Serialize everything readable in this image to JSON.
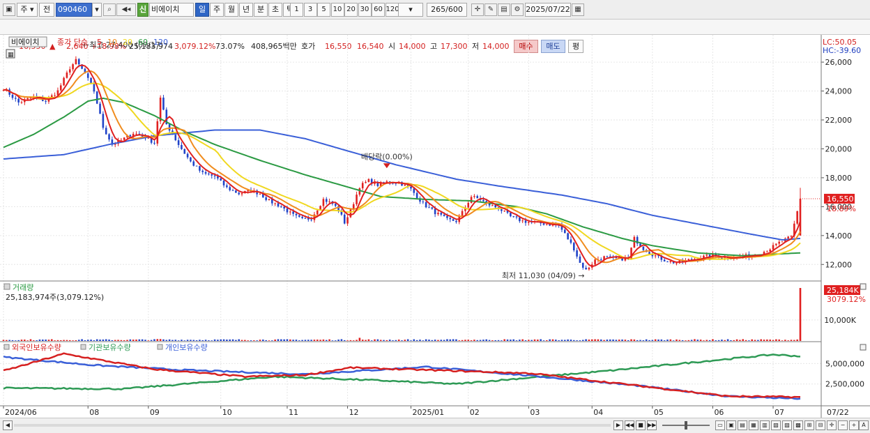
{
  "toolbar": {
    "market": "주",
    "type": "전",
    "code": "090460",
    "badge": "신",
    "name": "비에이치",
    "periods": [
      "일",
      "주",
      "월",
      "년",
      "분",
      "초",
      "틱"
    ],
    "active_period": "일",
    "minutes": [
      "1",
      "3",
      "5",
      "10",
      "20",
      "30",
      "60",
      "120"
    ],
    "count": "265",
    "count_total": "/600",
    "date": "2025/07/22"
  },
  "quote": {
    "price": "16,550",
    "change": "2,640",
    "change_pct": "+18.98%",
    "volume": "25,183,974",
    "volume_ratio": "3,079.12%",
    "turnover": "73.07%",
    "amount": "408,965백만",
    "ask_label": "호가",
    "ask": "16,550",
    "bid": "16,540",
    "open_label": "시",
    "open": "14,000",
    "high_label": "고",
    "high": "17,300",
    "low_label": "저",
    "low": "14,000",
    "buy_label": "매수",
    "sell_label": "매도",
    "eval_label": "평"
  },
  "chart_data": [
    {
      "type": "candlestick",
      "title": "비에이치",
      "ma_label": "종가 단순",
      "ma_periods": [
        "5",
        "10",
        "20",
        "60",
        "120"
      ],
      "ma_colors": [
        "#e02020",
        "#f08c1e",
        "#f0d820",
        "#2b9a43",
        "#3a5fd8"
      ],
      "lc_label": "LC:50.05",
      "hc_label": "HC:-39.60",
      "ylim": [
        11000,
        27500
      ],
      "yticks": [
        12000,
        14000,
        16000,
        18000,
        20000,
        22000,
        24000,
        26000
      ],
      "ytick_labels": [
        "12,000",
        "14,000",
        "16,000",
        "18,000",
        "20,000",
        "22,000",
        "24,000",
        "26,000"
      ],
      "x_months": [
        "2024/06",
        "08",
        "09",
        "10",
        "11",
        "12",
        "2025/01",
        "02",
        "03",
        "04",
        "05",
        "06",
        "07"
      ],
      "x_last_label": "07/22",
      "current_price_label": "16,550",
      "current_pct_label": "18.89%",
      "annotations": {
        "high": "최고 27,400 (07/17)",
        "low": "최저 11,030 (04/09)",
        "dividend": "배당락(0.00%)"
      },
      "close_path": [
        [
          0,
          24200
        ],
        [
          5,
          23200
        ],
        [
          10,
          23600
        ],
        [
          14,
          23300
        ],
        [
          18,
          24000
        ],
        [
          22,
          25600
        ],
        [
          24,
          26100
        ],
        [
          27,
          25200
        ],
        [
          30,
          24000
        ],
        [
          33,
          21500
        ],
        [
          36,
          20300
        ],
        [
          39,
          20600
        ],
        [
          43,
          21100
        ],
        [
          47,
          20800
        ],
        [
          50,
          20400
        ],
        [
          52,
          23500
        ],
        [
          54,
          21700
        ],
        [
          58,
          20300
        ],
        [
          62,
          19100
        ],
        [
          66,
          18300
        ],
        [
          70,
          18100
        ],
        [
          74,
          17300
        ],
        [
          78,
          16900
        ],
        [
          82,
          17100
        ],
        [
          85,
          16900
        ],
        [
          88,
          16400
        ],
        [
          92,
          16000
        ],
        [
          96,
          15400
        ],
        [
          99,
          15100
        ],
        [
          102,
          15200
        ],
        [
          106,
          16500
        ],
        [
          109,
          16200
        ],
        [
          111,
          15800
        ],
        [
          113,
          14900
        ],
        [
          115,
          15700
        ],
        [
          118,
          17400
        ],
        [
          121,
          17800
        ],
        [
          124,
          17500
        ],
        [
          127,
          17700
        ],
        [
          131,
          17700
        ],
        [
          135,
          17200
        ],
        [
          139,
          16200
        ],
        [
          143,
          15600
        ],
        [
          147,
          15100
        ],
        [
          150,
          15000
        ],
        [
          152,
          15600
        ],
        [
          155,
          16700
        ],
        [
          158,
          16500
        ],
        [
          160,
          16200
        ],
        [
          164,
          15900
        ],
        [
          168,
          15300
        ],
        [
          172,
          15000
        ],
        [
          176,
          14900
        ],
        [
          180,
          14800
        ],
        [
          184,
          14700
        ],
        [
          186,
          14100
        ],
        [
          189,
          13100
        ],
        [
          191,
          12100
        ],
        [
          193,
          11600
        ],
        [
          196,
          12300
        ],
        [
          199,
          12500
        ],
        [
          203,
          12400
        ],
        [
          207,
          12400
        ],
        [
          209,
          13800
        ],
        [
          212,
          13100
        ],
        [
          215,
          12700
        ],
        [
          219,
          12300
        ],
        [
          223,
          12100
        ],
        [
          227,
          12300
        ],
        [
          231,
          12500
        ],
        [
          235,
          12600
        ],
        [
          239,
          12500
        ],
        [
          243,
          12500
        ],
        [
          247,
          12600
        ],
        [
          251,
          12800
        ],
        [
          254,
          13100
        ],
        [
          257,
          13500
        ],
        [
          259,
          13700
        ],
        [
          261,
          13900
        ],
        [
          264,
          16550
        ]
      ],
      "ma120_path": [
        [
          0,
          19300
        ],
        [
          20,
          19600
        ],
        [
          35,
          20300
        ],
        [
          50,
          20900
        ],
        [
          70,
          21300
        ],
        [
          85,
          21300
        ],
        [
          100,
          20700
        ],
        [
          115,
          19800
        ],
        [
          130,
          18900
        ],
        [
          150,
          17900
        ],
        [
          165,
          17400
        ],
        [
          185,
          16800
        ],
        [
          200,
          16200
        ],
        [
          215,
          15400
        ],
        [
          230,
          14800
        ],
        [
          245,
          14200
        ],
        [
          258,
          13700
        ],
        [
          264,
          13800
        ]
      ],
      "ma60_path": [
        [
          0,
          20100
        ],
        [
          10,
          21000
        ],
        [
          20,
          22200
        ],
        [
          28,
          23300
        ],
        [
          33,
          23500
        ],
        [
          40,
          23200
        ],
        [
          50,
          22300
        ],
        [
          60,
          21200
        ],
        [
          70,
          20300
        ],
        [
          85,
          19200
        ],
        [
          100,
          18200
        ],
        [
          115,
          17300
        ],
        [
          125,
          16700
        ],
        [
          140,
          16500
        ],
        [
          155,
          16400
        ],
        [
          170,
          16000
        ],
        [
          180,
          15500
        ],
        [
          192,
          14600
        ],
        [
          205,
          13800
        ],
        [
          215,
          13300
        ],
        [
          230,
          12800
        ],
        [
          245,
          12600
        ],
        [
          264,
          12800
        ]
      ],
      "volume": {
        "title": "거래량",
        "value_label": "25,183,974주(3,079.12%)",
        "current_label": "25,184K",
        "current_pct": "3079.12%",
        "tick_label": "10,000K",
        "max": 25184,
        "last_value": 25184
      },
      "holdings": {
        "series_names": [
          "외국인보유수량",
          "기관보유수량",
          "개인보유수량"
        ],
        "series_colors": [
          "#d62020",
          "#2e9a55",
          "#3a5fd8"
        ],
        "yticks": [
          2500000,
          5000000
        ],
        "ytick_labels": [
          "2,500,000",
          "5,000,000"
        ],
        "ylim": [
          0,
          7000000
        ],
        "foreign": [
          [
            0,
            4100000
          ],
          [
            20,
            6200000
          ],
          [
            50,
            4300000
          ],
          [
            80,
            3400000
          ],
          [
            100,
            3600000
          ],
          [
            115,
            4500000
          ],
          [
            150,
            4100000
          ],
          [
            175,
            3800000
          ],
          [
            210,
            2300000
          ],
          [
            240,
            1000000
          ],
          [
            264,
            900000
          ]
        ],
        "institution": [
          [
            0,
            2000000
          ],
          [
            40,
            1900000
          ],
          [
            90,
            3400000
          ],
          [
            120,
            3000000
          ],
          [
            150,
            2500000
          ],
          [
            200,
            4100000
          ],
          [
            230,
            5200000
          ],
          [
            255,
            6100000
          ],
          [
            264,
            5900000
          ]
        ],
        "individual": [
          [
            0,
            5800000
          ],
          [
            30,
            4800000
          ],
          [
            60,
            4200000
          ],
          [
            100,
            3700000
          ],
          [
            140,
            4600000
          ],
          [
            175,
            3500000
          ],
          [
            210,
            2300000
          ],
          [
            240,
            1000000
          ],
          [
            264,
            700000
          ]
        ]
      }
    }
  ]
}
